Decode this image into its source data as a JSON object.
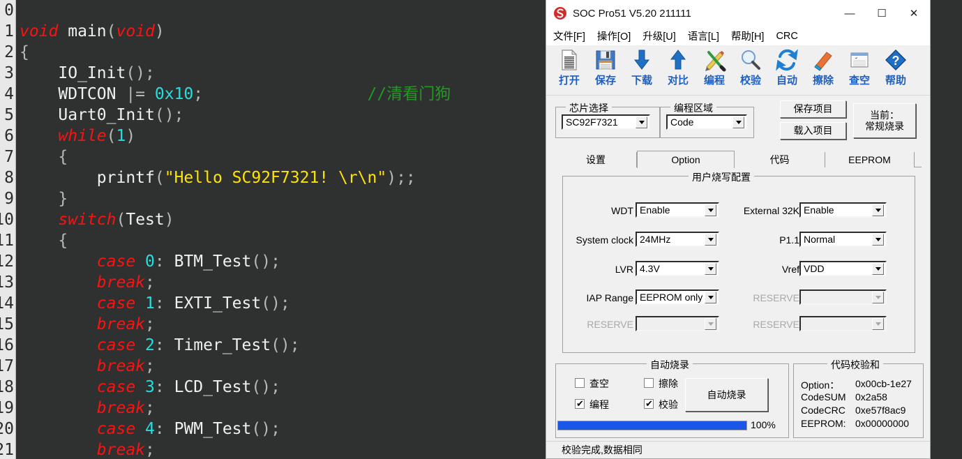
{
  "editor": {
    "first_line_number": 0,
    "lines": [
      {
        "n": "0",
        "tokens": []
      },
      {
        "n": "1",
        "tokens": [
          {
            "t": "void",
            "c": "kw"
          },
          {
            "t": " main",
            "c": "id"
          },
          {
            "t": "(",
            "c": "pun"
          },
          {
            "t": "void",
            "c": "kw"
          },
          {
            "t": ")",
            "c": "pun"
          }
        ]
      },
      {
        "n": "2",
        "tokens": [
          {
            "t": "{",
            "c": "pun"
          }
        ]
      },
      {
        "n": "3",
        "tokens": [
          {
            "t": "    IO_Init",
            "c": "id"
          },
          {
            "t": "();",
            "c": "pun"
          }
        ]
      },
      {
        "n": "4",
        "tokens": [
          {
            "t": "    WDTCON ",
            "c": "id"
          },
          {
            "t": "|= ",
            "c": "pun"
          },
          {
            "t": "0x10",
            "c": "num"
          },
          {
            "t": ";",
            "c": "pun"
          },
          {
            "t": "                 ",
            "c": "id"
          },
          {
            "t": "//清看门狗",
            "c": "cmt"
          }
        ]
      },
      {
        "n": "5",
        "tokens": [
          {
            "t": "    Uart0_Init",
            "c": "id"
          },
          {
            "t": "();",
            "c": "pun"
          }
        ]
      },
      {
        "n": "6",
        "tokens": [
          {
            "t": "    ",
            "c": "id"
          },
          {
            "t": "while",
            "c": "kw"
          },
          {
            "t": "(",
            "c": "pun"
          },
          {
            "t": "1",
            "c": "num"
          },
          {
            "t": ")",
            "c": "pun"
          }
        ]
      },
      {
        "n": "7",
        "tokens": [
          {
            "t": "    {",
            "c": "pun"
          }
        ]
      },
      {
        "n": "8",
        "tokens": [
          {
            "t": "        printf",
            "c": "id"
          },
          {
            "t": "(",
            "c": "pun"
          },
          {
            "t": "\"Hello SC92F7321! \\r\\n\"",
            "c": "str"
          },
          {
            "t": ");;",
            "c": "pun"
          }
        ]
      },
      {
        "n": "9",
        "tokens": [
          {
            "t": "    }",
            "c": "pun"
          }
        ]
      },
      {
        "n": "10",
        "tokens": [
          {
            "t": "    ",
            "c": "id"
          },
          {
            "t": "switch",
            "c": "kw"
          },
          {
            "t": "(",
            "c": "pun"
          },
          {
            "t": "Test",
            "c": "id"
          },
          {
            "t": ")",
            "c": "pun"
          }
        ]
      },
      {
        "n": "11",
        "tokens": [
          {
            "t": "    {",
            "c": "pun"
          }
        ]
      },
      {
        "n": "12",
        "tokens": [
          {
            "t": "        ",
            "c": "id"
          },
          {
            "t": "case ",
            "c": "kw"
          },
          {
            "t": "0",
            "c": "num"
          },
          {
            "t": ":",
            "c": "pun"
          },
          {
            "t": " BTM_Test",
            "c": "id"
          },
          {
            "t": "();",
            "c": "pun"
          }
        ]
      },
      {
        "n": "13",
        "tokens": [
          {
            "t": "        ",
            "c": "id"
          },
          {
            "t": "break",
            "c": "kw"
          },
          {
            "t": ";",
            "c": "pun"
          }
        ]
      },
      {
        "n": "14",
        "tokens": [
          {
            "t": "        ",
            "c": "id"
          },
          {
            "t": "case ",
            "c": "kw"
          },
          {
            "t": "1",
            "c": "num"
          },
          {
            "t": ":",
            "c": "pun"
          },
          {
            "t": " EXTI_Test",
            "c": "id"
          },
          {
            "t": "();",
            "c": "pun"
          }
        ]
      },
      {
        "n": "15",
        "tokens": [
          {
            "t": "        ",
            "c": "id"
          },
          {
            "t": "break",
            "c": "kw"
          },
          {
            "t": ";",
            "c": "pun"
          }
        ]
      },
      {
        "n": "16",
        "tokens": [
          {
            "t": "        ",
            "c": "id"
          },
          {
            "t": "case ",
            "c": "kw"
          },
          {
            "t": "2",
            "c": "num"
          },
          {
            "t": ":",
            "c": "pun"
          },
          {
            "t": " Timer_Test",
            "c": "id"
          },
          {
            "t": "();",
            "c": "pun"
          }
        ]
      },
      {
        "n": "17",
        "tokens": [
          {
            "t": "        ",
            "c": "id"
          },
          {
            "t": "break",
            "c": "kw"
          },
          {
            "t": ";",
            "c": "pun"
          }
        ]
      },
      {
        "n": "18",
        "tokens": [
          {
            "t": "        ",
            "c": "id"
          },
          {
            "t": "case ",
            "c": "kw"
          },
          {
            "t": "3",
            "c": "num"
          },
          {
            "t": ":",
            "c": "pun"
          },
          {
            "t": " LCD_Test",
            "c": "id"
          },
          {
            "t": "();",
            "c": "pun"
          }
        ]
      },
      {
        "n": "19",
        "tokens": [
          {
            "t": "        ",
            "c": "id"
          },
          {
            "t": "break",
            "c": "kw"
          },
          {
            "t": ";",
            "c": "pun"
          }
        ]
      },
      {
        "n": "20",
        "tokens": [
          {
            "t": "        ",
            "c": "id"
          },
          {
            "t": "case ",
            "c": "kw"
          },
          {
            "t": "4",
            "c": "num"
          },
          {
            "t": ":",
            "c": "pun"
          },
          {
            "t": " PWM_Test",
            "c": "id"
          },
          {
            "t": "();",
            "c": "pun"
          }
        ]
      },
      {
        "n": "21",
        "tokens": [
          {
            "t": "        ",
            "c": "id"
          },
          {
            "t": "break",
            "c": "kw"
          },
          {
            "t": ";",
            "c": "pun"
          }
        ]
      }
    ],
    "colors": {
      "background": "#2f3030",
      "gutter": "#e8e8e8",
      "keyword": "#ff1111",
      "number": "#22e0e0",
      "string": "#ffe400",
      "comment": "#1f9b1f",
      "text": "#e0e0e0"
    }
  },
  "window": {
    "title": "SOC Pro51 V5.20 211111",
    "app_icon": "soc-logo-icon",
    "controls": {
      "minimize": "—",
      "maximize": "☐",
      "close": "✕"
    }
  },
  "menubar": {
    "items": [
      {
        "label": "文件[F]",
        "name": "menu-file"
      },
      {
        "label": "操作[O]",
        "name": "menu-operation"
      },
      {
        "label": "升级[U]",
        "name": "menu-upgrade"
      },
      {
        "label": "语言[L]",
        "name": "menu-language"
      },
      {
        "label": "帮助[H]",
        "name": "menu-help"
      },
      {
        "label": "CRC",
        "name": "menu-crc"
      }
    ]
  },
  "toolbar": {
    "items": [
      {
        "label": "打开",
        "icon": "document-open-icon"
      },
      {
        "label": "保存",
        "icon": "floppy-save-icon"
      },
      {
        "label": "下载",
        "icon": "arrow-down-icon"
      },
      {
        "label": "对比",
        "icon": "arrow-up-icon"
      },
      {
        "label": "编程",
        "icon": "pencil-brush-icon"
      },
      {
        "label": "校验",
        "icon": "magnifier-icon"
      },
      {
        "label": "自动",
        "icon": "refresh-cycle-icon"
      },
      {
        "label": "擦除",
        "icon": "eraser-icon"
      },
      {
        "label": "查空",
        "icon": "blank-check-window-icon"
      },
      {
        "label": "帮助",
        "icon": "question-diamond-icon"
      }
    ]
  },
  "chip_select": {
    "group_title": "芯片选择",
    "value": "SC92F7321"
  },
  "program_area": {
    "group_title": "编程区域",
    "value": "Code"
  },
  "project_buttons": {
    "save_project": "保存项目",
    "load_project": "载入项目",
    "mode_line1": "当前：",
    "mode_line2": "常规烧录"
  },
  "tabs": [
    {
      "label": "设置",
      "selected": false
    },
    {
      "label": "Option",
      "selected": true
    },
    {
      "label": "代码",
      "selected": false
    },
    {
      "label": "EEPROM",
      "selected": false
    }
  ],
  "option_panel": {
    "group_title": "用户烧写配置",
    "fields_left": [
      {
        "label": "WDT",
        "value": "Enable",
        "disabled": false
      },
      {
        "label": "System clock",
        "value": "24MHz",
        "disabled": false
      },
      {
        "label": "LVR",
        "value": "4.3V",
        "disabled": false
      },
      {
        "label": "IAP Range",
        "value": "EEPROM only",
        "disabled": false
      },
      {
        "label": "RESERVE",
        "value": "",
        "disabled": true
      }
    ],
    "fields_right": [
      {
        "label": "External 32K",
        "value": "Enable",
        "disabled": false
      },
      {
        "label": "P1.1",
        "value": "Normal",
        "disabled": false
      },
      {
        "label": "Vref",
        "value": "VDD",
        "disabled": false
      },
      {
        "label": "RESERVE",
        "value": "",
        "disabled": true
      },
      {
        "label": "RESERVE",
        "value": "",
        "disabled": true
      }
    ]
  },
  "auto_burn": {
    "group_title": "自动烧录",
    "checkboxes": [
      {
        "label": "查空",
        "checked": false
      },
      {
        "label": "擦除",
        "checked": false
      },
      {
        "label": "编程",
        "checked": true
      },
      {
        "label": "校验",
        "checked": true
      }
    ],
    "button_label": "自动烧录",
    "progress_percent": "100%",
    "progress_value": 100
  },
  "checksum": {
    "group_title": "代码校验和",
    "rows": [
      {
        "label": "Option：",
        "value": "0x00cb-1e27"
      },
      {
        "label": "CodeSUM",
        "value": "0x2a58"
      },
      {
        "label": "CodeCRC",
        "value": "0xe57f8ac9"
      },
      {
        "label": "EEPROM:",
        "value": "0x00000000"
      }
    ]
  },
  "statusbar": {
    "text": "校验完成,数据相同"
  },
  "theme": {
    "accent": "#1f5fbf",
    "progress": "#1a56e8",
    "window_bg": "#f0f0f0",
    "editor_bg": "#2f3030"
  }
}
